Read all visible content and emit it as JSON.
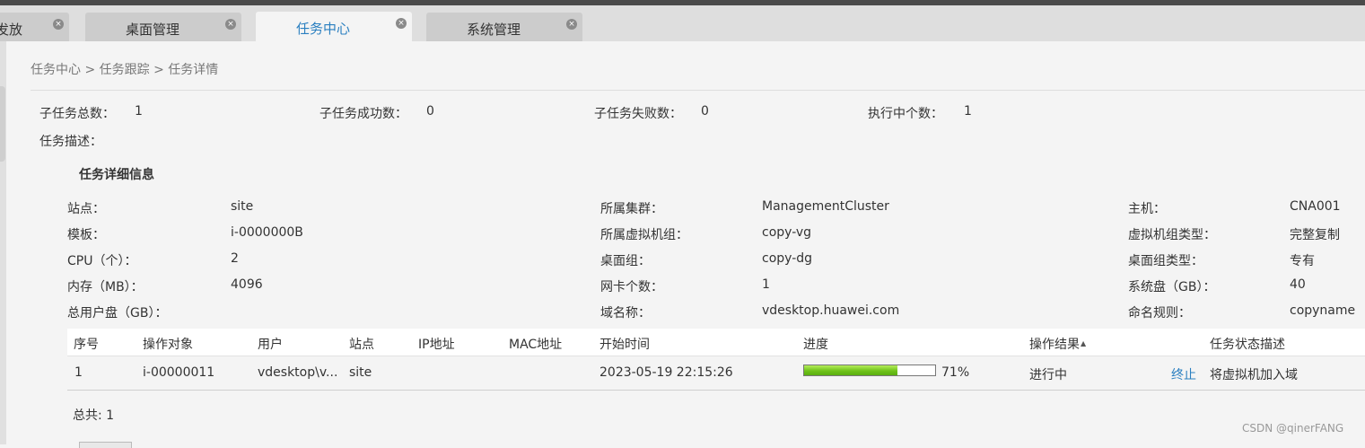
{
  "tabs": [
    {
      "label": "发放",
      "active": false
    },
    {
      "label": "桌面管理",
      "active": false
    },
    {
      "label": "任务中心",
      "active": true
    },
    {
      "label": "系统管理",
      "active": false
    }
  ],
  "tab_close_glyph": "×",
  "breadcrumb": "任务中心 > 任务跟踪 > 任务详情",
  "summary": {
    "total_label": "子任务总数：",
    "total": "1",
    "success_label": "子任务成功数：",
    "success": "0",
    "fail_label": "子任务失败数：",
    "fail": "0",
    "running_label": "执行中个数：",
    "running": "1",
    "desc_label": "任务描述："
  },
  "detail": {
    "title": "任务详细信息",
    "site_label": "站点：",
    "site": "site",
    "cluster_label": "所属集群：",
    "cluster": "ManagementCluster",
    "host_label": "主机：",
    "host": "CNA001",
    "template_label": "模板：",
    "template": "i-0000000B",
    "vmgroup_label": "所属虚拟机组：",
    "vmgroup": "copy-vg",
    "vmgroup_type_label": "虚拟机组类型：",
    "vmgroup_type": "完整复制",
    "cpu_label": "CPU（个）：",
    "cpu": "2",
    "desktop_group_label": "桌面组：",
    "desktop_group": "copy-dg",
    "desktop_group_type_label": "桌面组类型：",
    "desktop_group_type": "专有",
    "memory_label": "内存（MB）：",
    "memory": "4096",
    "nic_label": "网卡个数：",
    "nic": "1",
    "sysdisk_label": "系统盘（GB）：",
    "sysdisk": "40",
    "userdisk_label": "总用户盘（GB）：",
    "userdisk": "",
    "domain_label": "域名称：",
    "domain": "vdesktop.huawei.com",
    "naming_label": "命名规则：",
    "naming": "copyname"
  },
  "table": {
    "columns": [
      "序号",
      "操作对象",
      "用户",
      "站点",
      "IP地址",
      "MAC地址",
      "开始时间",
      "进度",
      "操作结果",
      "任务状态描述"
    ],
    "sort_glyph": "▲",
    "rows": [
      {
        "index": "1",
        "target": "i-00000011",
        "user": "vdesktop\\v...",
        "site": "site",
        "ip": "",
        "mac": "",
        "start_time": "2023-05-19 22:15:26",
        "progress": 71,
        "progress_text": "71%",
        "result": "进行中",
        "action": "终止",
        "status_desc": "将虚拟机加入域"
      }
    ],
    "total_text": "总共: 1"
  },
  "watermark": "CSDN @qinerFANG",
  "colors": {
    "accent": "#2a7fc0",
    "progress_green": "#6fc21a"
  }
}
